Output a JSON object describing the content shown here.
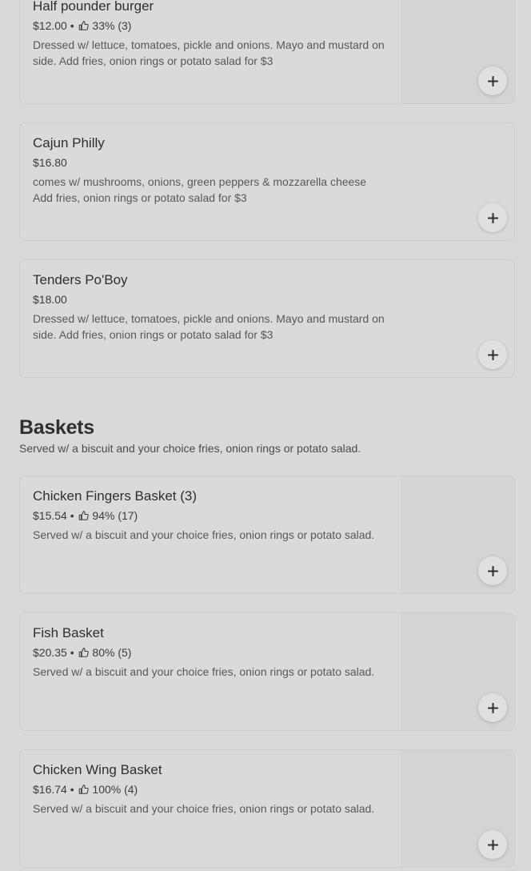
{
  "items_top": [
    {
      "name": "Half pounder burger",
      "price": "$12.00",
      "rating": "33% (3)",
      "description": "Dressed w/ lettuce, tomatoes, pickle and onions. Mayo and mustard on side. Add fries, onion rings or potato salad for $3"
    },
    {
      "name": "Cajun Philly",
      "price": "$16.80",
      "rating": "",
      "description": "comes w/ mushrooms, onions, green peppers & mozzarella cheese Add fries, onion rings or potato salad for $3"
    },
    {
      "name": "Tenders Po'Boy",
      "price": "$18.00",
      "rating": "",
      "description": "Dressed w/ lettuce, tomatoes, pickle and onions. Mayo and mustard on side. Add fries, onion rings or potato salad for $3"
    }
  ],
  "baskets": {
    "title": "Baskets",
    "description": "Served w/ a biscuit and your choice fries, onion rings or potato salad.",
    "items": [
      {
        "name": "Chicken Fingers Basket (3)",
        "price": "$15.54",
        "rating": "94% (17)",
        "description": "Served w/ a biscuit and your choice fries, onion rings or potato salad."
      },
      {
        "name": "Fish Basket",
        "price": "$20.35",
        "rating": "80% (5)",
        "description": "Served w/ a biscuit and your choice fries, onion rings or potato salad."
      },
      {
        "name": "Chicken Wing Basket",
        "price": "$16.74",
        "rating": "100% (4)",
        "description": "Served w/ a biscuit and your choice fries, onion rings or potato salad."
      }
    ]
  },
  "meta_separator": "•",
  "icons": {
    "rating": "thumbs-up-icon",
    "add": "plus-icon"
  },
  "colors": {
    "background": "#d9d9d9",
    "card": "#dadada",
    "text": "#2f2f2f"
  }
}
